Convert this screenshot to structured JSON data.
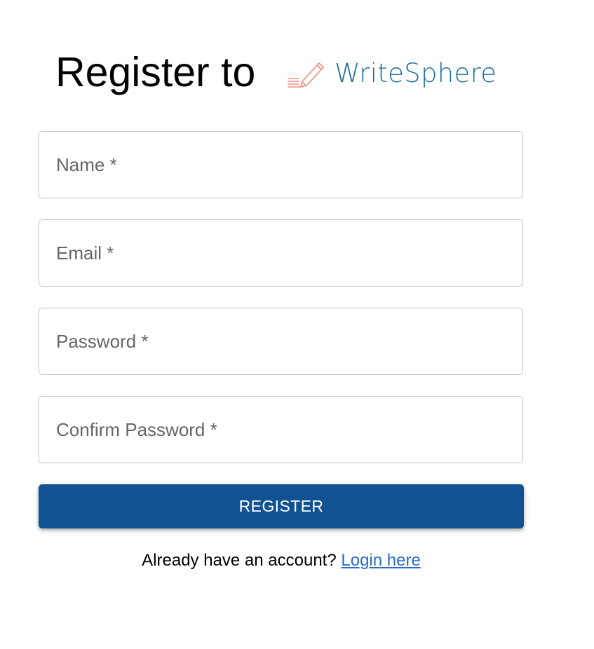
{
  "heading": "Register to",
  "logo": {
    "text": "WriteSphere",
    "icon": "pencil-writing-icon",
    "colors": {
      "text": "#1e6f9a",
      "icon": "#f08a7e"
    }
  },
  "form": {
    "fields": [
      {
        "label": "Name *",
        "value": ""
      },
      {
        "label": "Email *",
        "value": ""
      },
      {
        "label": "Password *",
        "value": ""
      },
      {
        "label": "Confirm Password *",
        "value": ""
      }
    ],
    "submit_label": "REGISTER"
  },
  "footer": {
    "prompt": "Already have an account?",
    "link_label": "Login here"
  },
  "colors": {
    "primary": "#115293",
    "link": "#2b6cc4",
    "border": "#c4c4c4",
    "label": "#666666"
  }
}
